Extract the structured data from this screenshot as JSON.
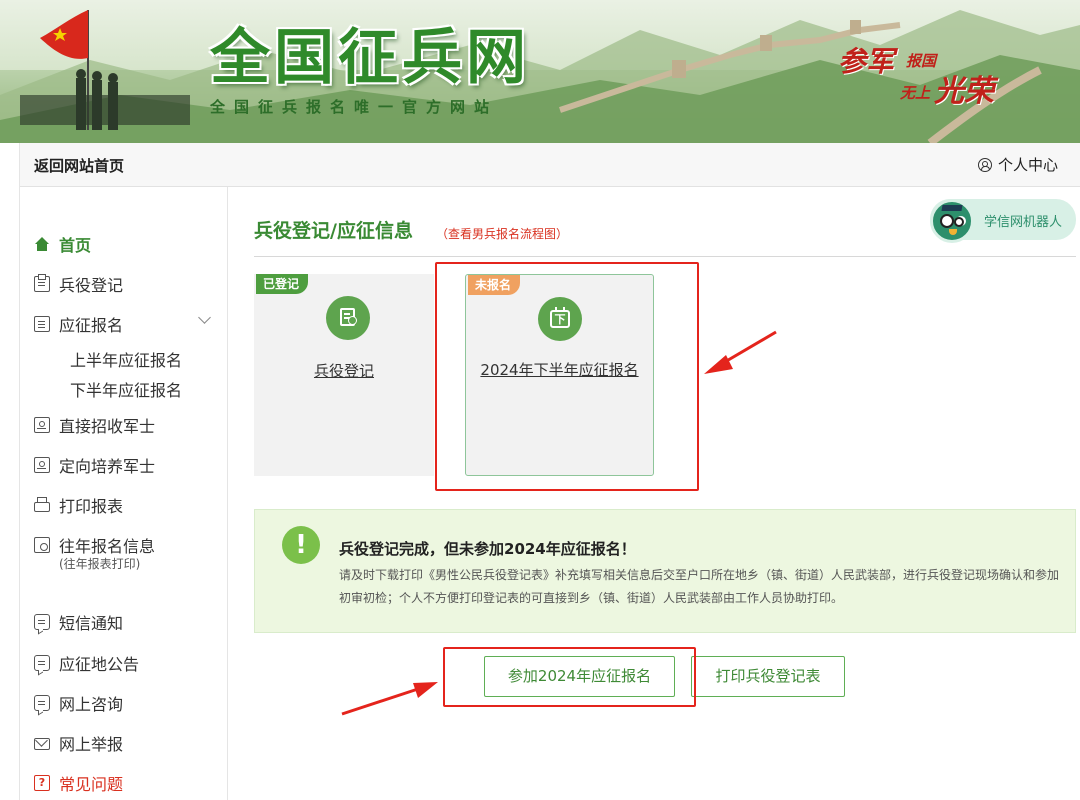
{
  "banner": {
    "title": "全国征兵网",
    "subtitle": "全国征兵报名唯一官方网站",
    "slogan": {
      "part1": "参军",
      "part2": "报国",
      "part3": "无上",
      "part4": "光荣"
    }
  },
  "topbar": {
    "back_home": "返回网站首页",
    "user_center": "个人中心"
  },
  "sidebar": {
    "items": [
      {
        "label": "首页",
        "icon": "home-icon",
        "active": true
      },
      {
        "label": "兵役登记",
        "icon": "clipboard-icon"
      },
      {
        "label": "应征报名",
        "icon": "document-icon",
        "expanded": true,
        "children": [
          "上半年应征报名",
          "下半年应征报名"
        ]
      },
      {
        "label": "直接招收军士",
        "icon": "badge-icon"
      },
      {
        "label": "定向培养军士",
        "icon": "badge-icon"
      },
      {
        "label": "打印报表",
        "icon": "printer-icon"
      },
      {
        "label": "往年报名信息",
        "note": "(往年报表打印)",
        "icon": "history-icon"
      },
      {
        "label": "短信通知",
        "icon": "chat-icon"
      },
      {
        "label": "应征地公告",
        "icon": "chat-icon"
      },
      {
        "label": "网上咨询",
        "icon": "chat-icon"
      },
      {
        "label": "网上举报",
        "icon": "mail-icon"
      },
      {
        "label": "常见问题",
        "icon": "help-icon"
      }
    ]
  },
  "main": {
    "title": "兵役登记/应征信息",
    "flow_link": "（查看男兵报名流程图）",
    "robot_label": "学信网机器人",
    "cards": [
      {
        "tag": "已登记",
        "label": "兵役登记"
      },
      {
        "tag": "未报名",
        "label": "2024年下半年应征报名",
        "icon_char": "下"
      }
    ],
    "notice": {
      "title": "兵役登记完成，但未参加2024年应征报名！",
      "body": "请及时下载打印《男性公民兵役登记表》补充填写相关信息后交至户口所在地乡（镇、街道）人民武装部，进行兵役登记现场确认和参加初审初检；个人不方便打印登记表的可直接到乡（镇、街道）人民武装部由工作人员协助打印。"
    },
    "buttons": {
      "apply": "参加2024年应征报名",
      "print": "打印兵役登记表"
    }
  },
  "colors": {
    "brand_green": "#3a8a34",
    "alert_red": "#e4241c",
    "tag_orange": "#f0a160"
  }
}
